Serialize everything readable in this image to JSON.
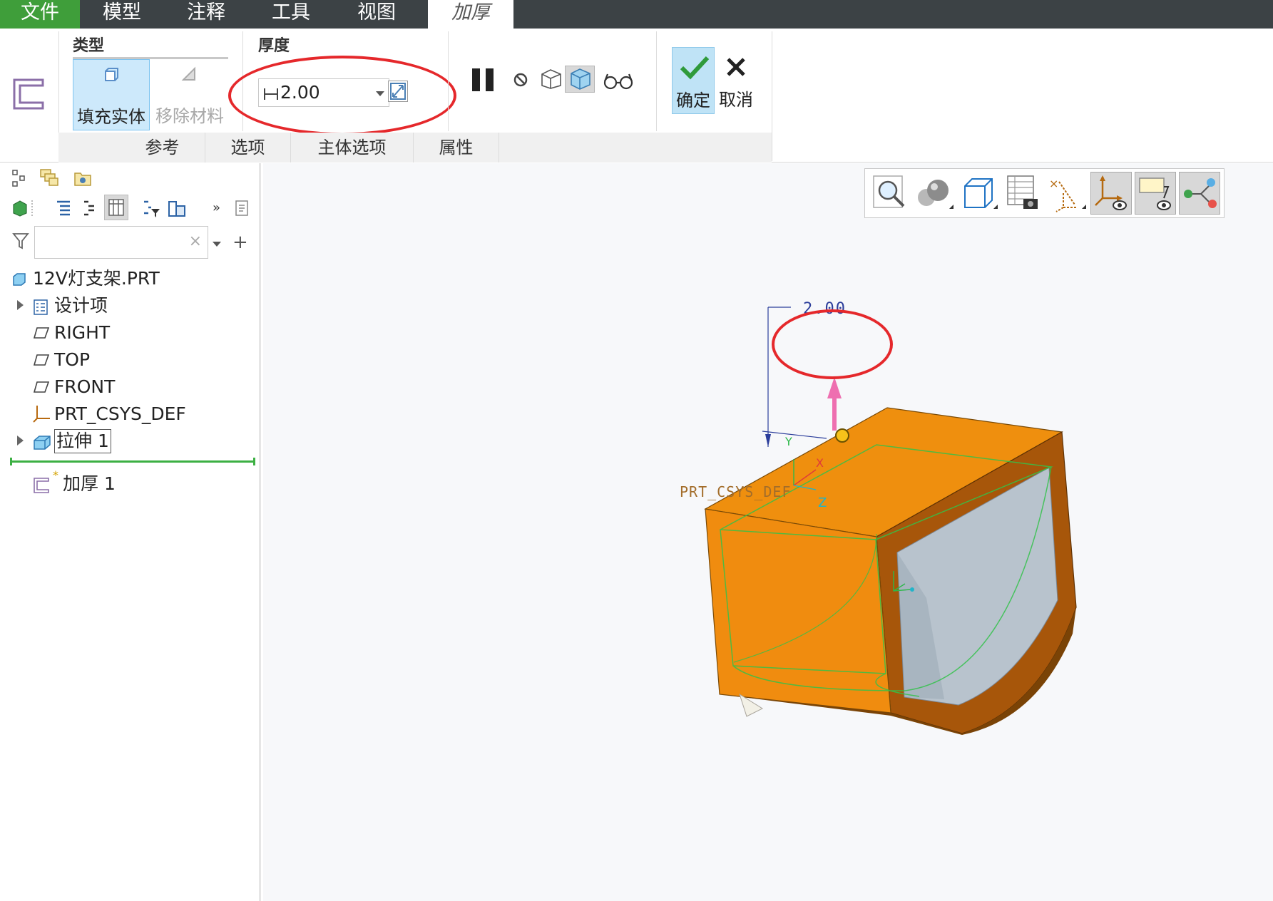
{
  "menu": {
    "file": "文件",
    "model": "模型",
    "annotate": "注释",
    "tools": "工具",
    "view": "视图",
    "active_tab": "加厚"
  },
  "ribbon": {
    "type_group_label": "类型",
    "fill_solid_label": "填充实体",
    "remove_material_label": "移除材料",
    "thickness_group_label": "厚度",
    "thickness_value": "2.00",
    "confirm_label": "确定",
    "cancel_label": "取消",
    "tabs": [
      "参考",
      "选项",
      "主体选项",
      "属性"
    ]
  },
  "tree": {
    "root": "12V灯支架.PRT",
    "items": [
      "设计项",
      "RIGHT",
      "TOP",
      "FRONT",
      "PRT_CSYS_DEF",
      "拉伸 1"
    ],
    "new_feature": "加厚 1"
  },
  "viewport": {
    "dimension_value": "2.00",
    "csys_label": "PRT_CSYS_DEF",
    "axis_y": "Y",
    "axis_x": "X",
    "axis_z": "Z"
  },
  "colors": {
    "menubar": "#3c4245",
    "file_tab": "#3f9e3a",
    "highlight_ellipse": "#e5282b",
    "part_orange": "#e88a0c",
    "part_inner": "#b8c3cd",
    "selection_blue": "#cde9fb"
  },
  "icons": {
    "thicken_feature": "thicken-icon",
    "pause": "pause-icon",
    "no_preview": "no-preview-icon",
    "wireframe_preview": "wireframe-preview-icon",
    "solid_preview": "solid-preview-icon",
    "verify": "glasses-icon",
    "confirm": "checkmark-icon",
    "cancel": "close-icon"
  }
}
